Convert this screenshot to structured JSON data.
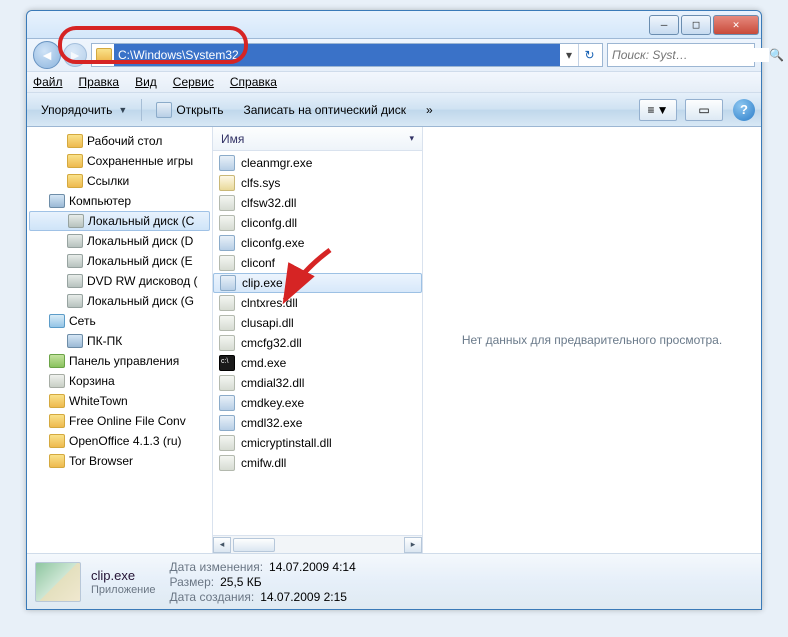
{
  "address_path": "C:\\Windows\\System32",
  "search_placeholder": "Поиск: Syst…",
  "menubar": {
    "file": "Файл",
    "edit": "Правка",
    "view": "Вид",
    "tools": "Сервис",
    "help": "Справка"
  },
  "toolbar": {
    "organize": "Упорядочить",
    "open": "Открыть",
    "burn": "Записать на оптический диск",
    "more": "»"
  },
  "tree": [
    {
      "label": "Рабочий стол",
      "icon": "folder",
      "lvl": 2
    },
    {
      "label": "Сохраненные игры",
      "icon": "folder",
      "lvl": 2
    },
    {
      "label": "Ссылки",
      "icon": "folder",
      "lvl": 2
    },
    {
      "label": "Компьютер",
      "icon": "pc",
      "lvl": 1
    },
    {
      "label": "Локальный диск (C",
      "icon": "drive",
      "lvl": 2,
      "sel": true
    },
    {
      "label": "Локальный диск (D",
      "icon": "drive",
      "lvl": 2
    },
    {
      "label": "Локальный диск (E",
      "icon": "drive",
      "lvl": 2
    },
    {
      "label": "DVD RW дисковод (",
      "icon": "drive",
      "lvl": 2
    },
    {
      "label": "Локальный диск (G",
      "icon": "drive",
      "lvl": 2
    },
    {
      "label": "Сеть",
      "icon": "net",
      "lvl": 1
    },
    {
      "label": "ПК-ПК",
      "icon": "pc",
      "lvl": 2
    },
    {
      "label": "Панель управления",
      "icon": "cp",
      "lvl": 1
    },
    {
      "label": "Корзина",
      "icon": "bin",
      "lvl": 1
    },
    {
      "label": "WhiteTown",
      "icon": "folder",
      "lvl": 1
    },
    {
      "label": "Free Online File Conv",
      "icon": "folder",
      "lvl": 1
    },
    {
      "label": "OpenOffice 4.1.3 (ru)",
      "icon": "folder",
      "lvl": 1
    },
    {
      "label": "Tor Browser",
      "icon": "folder",
      "lvl": 1
    }
  ],
  "column_header": "Имя",
  "files": [
    {
      "name": "cleanmgr.exe",
      "t": "exe"
    },
    {
      "name": "clfs.sys",
      "t": "sys"
    },
    {
      "name": "clfsw32.dll",
      "t": "dll"
    },
    {
      "name": "cliconfg.dll",
      "t": "dll"
    },
    {
      "name": "cliconfg.exe",
      "t": "exe"
    },
    {
      "name": "cliconf",
      "t": "dll"
    },
    {
      "name": "clip.exe",
      "t": "exe",
      "sel": true
    },
    {
      "name": "clntxres.dll",
      "t": "dll"
    },
    {
      "name": "clusapi.dll",
      "t": "dll"
    },
    {
      "name": "cmcfg32.dll",
      "t": "dll"
    },
    {
      "name": "cmd.exe",
      "t": "cmd"
    },
    {
      "name": "cmdial32.dll",
      "t": "dll"
    },
    {
      "name": "cmdkey.exe",
      "t": "exe"
    },
    {
      "name": "cmdl32.exe",
      "t": "exe"
    },
    {
      "name": "cmicryptinstall.dll",
      "t": "dll"
    },
    {
      "name": "cmifw.dll",
      "t": "dll"
    }
  ],
  "preview_empty": "Нет данных для предварительного просмотра.",
  "details": {
    "name": "clip.exe",
    "type": "Приложение",
    "mod_label": "Дата изменения:",
    "mod_val": "14.07.2009 4:14",
    "size_label": "Размер:",
    "size_val": "25,5 КБ",
    "created_label": "Дата создания:",
    "created_val": "14.07.2009 2:15"
  }
}
